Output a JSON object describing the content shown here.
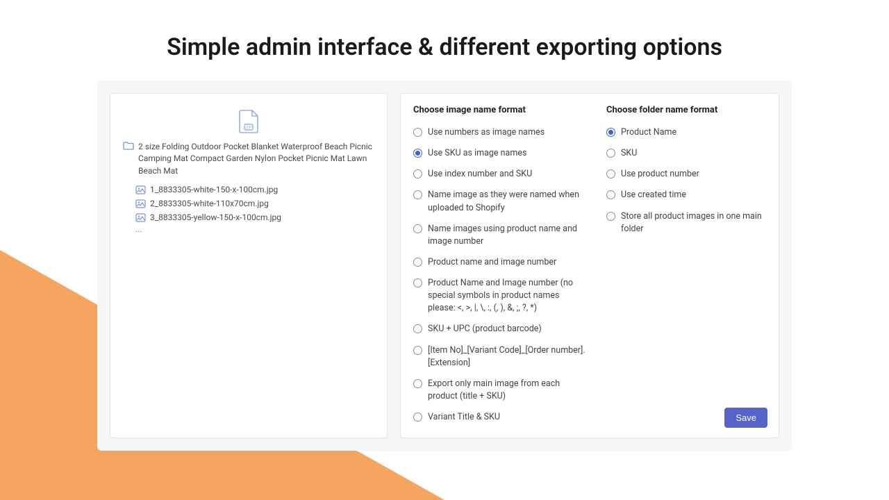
{
  "title": "Simple admin interface & different exporting options",
  "preview": {
    "folder_name": "2 size Folding Outdoor Pocket Blanket Waterproof Beach Picnic Camping Mat Compact Garden Nylon Pocket Picnic Mat Lawn Beach Mat",
    "files": [
      "1_8833305-white-150-x-100cm.jpg",
      "2_8833305-white-110x70cm.jpg",
      "3_8833305-yellow-150-x-100cm.jpg"
    ],
    "ellipsis": "..."
  },
  "image_format": {
    "heading": "Choose image name format",
    "options": [
      "Use numbers as image names",
      "Use SKU as image names",
      "Use index number and SKU",
      "Name image as they were named when uploaded to Shopify",
      "Name images using product name and image number",
      "Product name and image number",
      "Product Name and Image number (no special symbols in product names please: <, >, |, \\, :, (, ), &, ;, ?, *)",
      "SKU + UPC (product barcode)",
      "[Item No]_[Variant Code]_[Order number].[Extension]",
      "Export only main image from each product (title + SKU)",
      "Variant Title & SKU"
    ],
    "selected": 1
  },
  "folder_format": {
    "heading": "Choose folder name format",
    "options": [
      "Product Name",
      "SKU",
      "Use product number",
      "Use created time",
      "Store all product images in one main folder"
    ],
    "selected": 0
  },
  "save_label": "Save"
}
